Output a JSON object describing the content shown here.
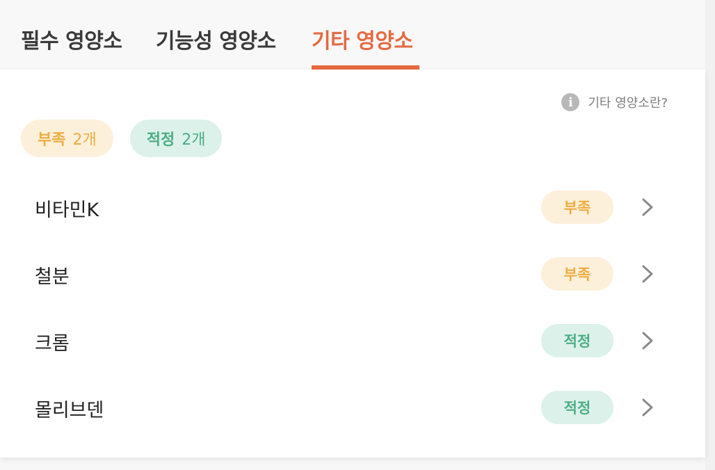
{
  "tabs": [
    {
      "label": "필수 영양소",
      "active": false
    },
    {
      "label": "기능성 영양소",
      "active": false
    },
    {
      "label": "기타 영양소",
      "active": true
    }
  ],
  "help_label": "기타 영양소란?",
  "summary": {
    "lack": {
      "label": "부족",
      "count": "2개"
    },
    "ok": {
      "label": "적정",
      "count": "2개"
    }
  },
  "nutrients": [
    {
      "name": "비타민K",
      "status": "부족"
    },
    {
      "name": "철분",
      "status": "부족"
    },
    {
      "name": "크롬",
      "status": "적정"
    },
    {
      "name": "몰리브덴",
      "status": "적정"
    }
  ],
  "colors": {
    "accent": "#e46a41",
    "lack_bg": "#fdf0db",
    "lack_text": "#eeac3f",
    "ok_bg": "#dcf1ea",
    "ok_text": "#4bae86"
  }
}
